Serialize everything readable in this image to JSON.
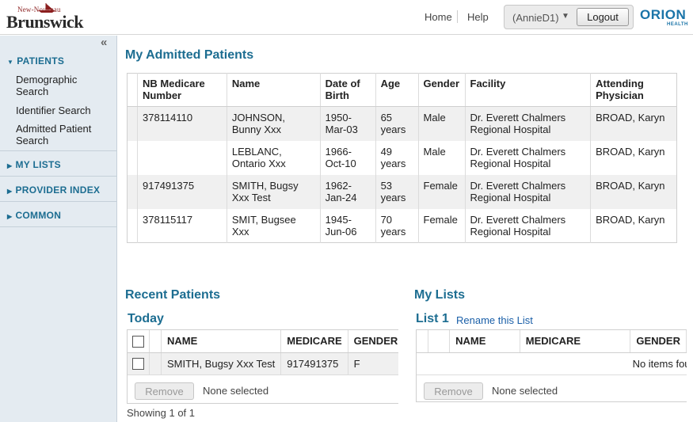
{
  "header": {
    "logo_small": "New-Nouveau",
    "logo_big": "Brunswick",
    "home": "Home",
    "help": "Help",
    "user": "(AnnieD1)",
    "logout": "Logout",
    "brand": "ORION",
    "brand_sub": "HEALTH"
  },
  "sidebar": {
    "collapse": "«",
    "sections": [
      {
        "label": "PATIENTS",
        "expanded": true
      },
      {
        "label": "MY LISTS",
        "expanded": false
      },
      {
        "label": "PROVIDER INDEX",
        "expanded": false
      },
      {
        "label": "COMMON",
        "expanded": false
      }
    ],
    "patient_items": [
      "Demographic Search",
      "Identifier Search",
      "Admitted Patient Search"
    ]
  },
  "admitted": {
    "title": "My Admitted Patients",
    "columns": [
      "NB Medicare Number",
      "Name",
      "Date of Birth",
      "Age",
      "Gender",
      "Facility",
      "Attending Physician"
    ],
    "rows": [
      [
        "378114110",
        "JOHNSON, Bunny Xxx",
        "1950-Mar-03",
        "65 years",
        "Male",
        "Dr. Everett Chalmers Regional Hospital",
        "BROAD, Karyn"
      ],
      [
        "",
        "LEBLANC, Ontario Xxx",
        "1966-Oct-10",
        "49 years",
        "Male",
        "Dr. Everett Chalmers Regional Hospital",
        "BROAD, Karyn"
      ],
      [
        "917491375",
        "SMITH, Bugsy Xxx Test",
        "1962-Jan-24",
        "53 years",
        "Female",
        "Dr. Everett Chalmers Regional Hospital",
        "BROAD, Karyn"
      ],
      [
        "378115117",
        "SMIT, Bugsee Xxx",
        "1945-Jun-06",
        "70 years",
        "Female",
        "Dr. Everett Chalmers Regional Hospital",
        "BROAD, Karyn"
      ]
    ]
  },
  "recent": {
    "title": "Recent Patients",
    "subtitle": "Today",
    "columns": [
      "NAME",
      "MEDICARE",
      "GENDER"
    ],
    "rows": [
      [
        "SMITH, Bugsy Xxx Test",
        "917491375",
        "F"
      ]
    ],
    "remove": "Remove",
    "none_selected": "None selected",
    "showing": "Showing 1 of 1"
  },
  "mylists": {
    "title": "My Lists",
    "list_name": "List 1",
    "rename": "Rename this List",
    "columns": [
      "NAME",
      "MEDICARE",
      "GENDER"
    ],
    "empty": "No items found",
    "remove": "Remove",
    "none_selected": "None selected"
  },
  "colors": {
    "accent": "#1c6d91",
    "sidebar_bg": "#e4ebf1",
    "link": "#1a5fa8",
    "brand": "#1a74a8"
  }
}
